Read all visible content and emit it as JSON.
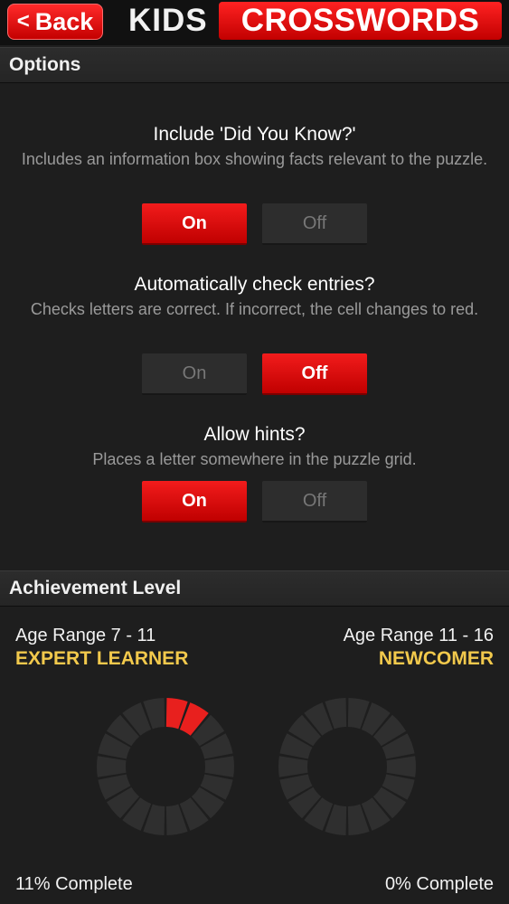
{
  "header": {
    "back_label": "Back",
    "back_icon": "chevron-left-icon",
    "title_part1": "KIDS",
    "title_part2": "CROSSWORDS"
  },
  "options_section": {
    "title": "Options",
    "items": [
      {
        "title": "Include 'Did You Know?'",
        "description": "Includes an information box showing facts relevant to the puzzle.",
        "on_label": "On",
        "off_label": "Off",
        "selected": "on"
      },
      {
        "title": "Automatically check entries?",
        "description": "Checks letters are correct. If incorrect, the cell changes to red.",
        "on_label": "On",
        "off_label": "Off",
        "selected": "off"
      },
      {
        "title": "Allow hints?",
        "description": "Places a letter somewhere in the puzzle grid.",
        "on_label": "On",
        "off_label": "Off",
        "selected": "on"
      }
    ]
  },
  "achievement_section": {
    "title": "Achievement Level",
    "groups": [
      {
        "age_range": "Age Range 7 - 11",
        "level": "EXPERT LEARNER",
        "complete_text": "11% Complete",
        "segments_total": 18,
        "segments_filled": 2
      },
      {
        "age_range": "Age Range 11 - 16",
        "level": "NEWCOMER",
        "complete_text": "0% Complete",
        "segments_total": 18,
        "segments_filled": 0
      }
    ]
  },
  "colors": {
    "accent_red": "#e8201e",
    "level_gold": "#f2c94c",
    "segment_empty": "#2f2f2f",
    "background": "#1e1e1e"
  }
}
